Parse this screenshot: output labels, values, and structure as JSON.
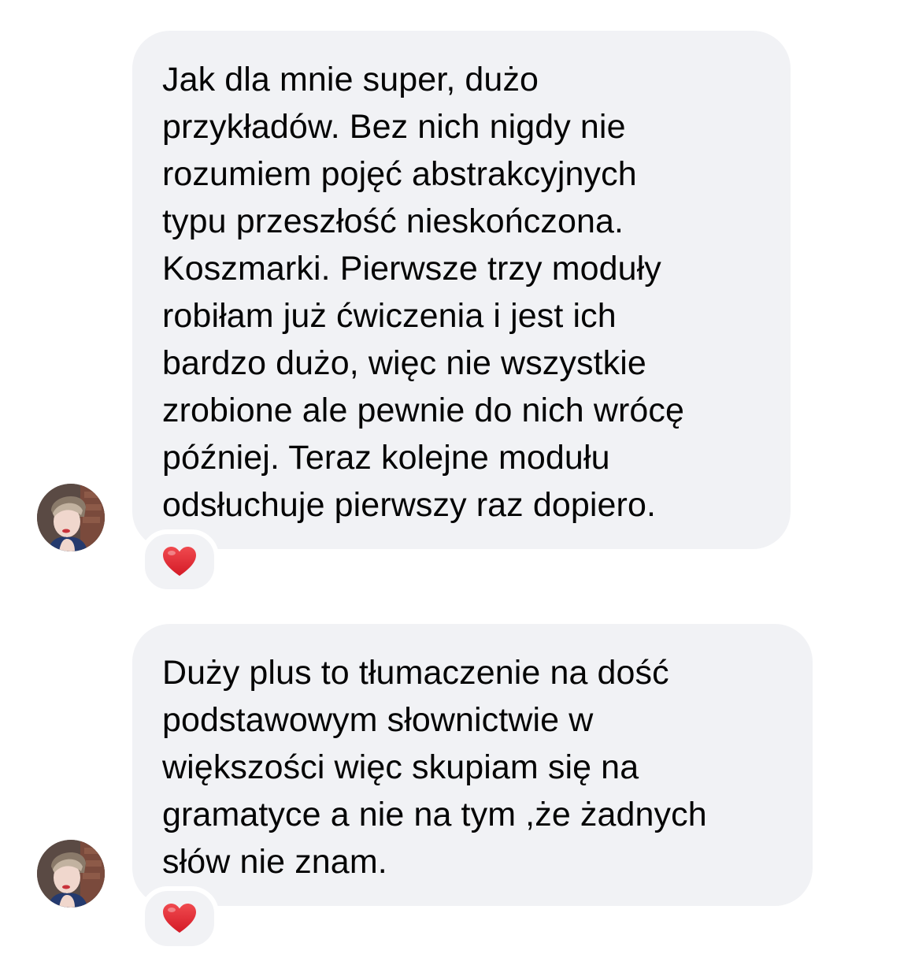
{
  "messages": [
    {
      "text": "Jak dla mnie super, dużo\nprzykładów. Bez nich nigdy nie\nrozumiem pojęć abstrakcyjnych\ntypu przeszłość nieskończona.\nKoszmarki. Pierwsze trzy moduły\nrobiłam już ćwiczenia i jest ich\nbardzo dużo, więc nie wszystkie\nzrobione ale pewnie do nich wrócę\npóźniej. Teraz kolejne modułu\nodsłuchuje pierwszy raz dopiero.",
      "reaction_icon": "red-heart-icon"
    },
    {
      "text": "Duży plus to tłumaczenie na dość\npodstawowym słownictwie w\nwiększości więc skupiam się na\ngramatyce a nie na tym ,że żadnych\nsłów nie znam.",
      "reaction_icon": "red-heart-icon"
    }
  ],
  "colors": {
    "bubble": "#f1f2f5",
    "text": "#050505",
    "heart": "#e0242f",
    "background": "#ffffff"
  }
}
